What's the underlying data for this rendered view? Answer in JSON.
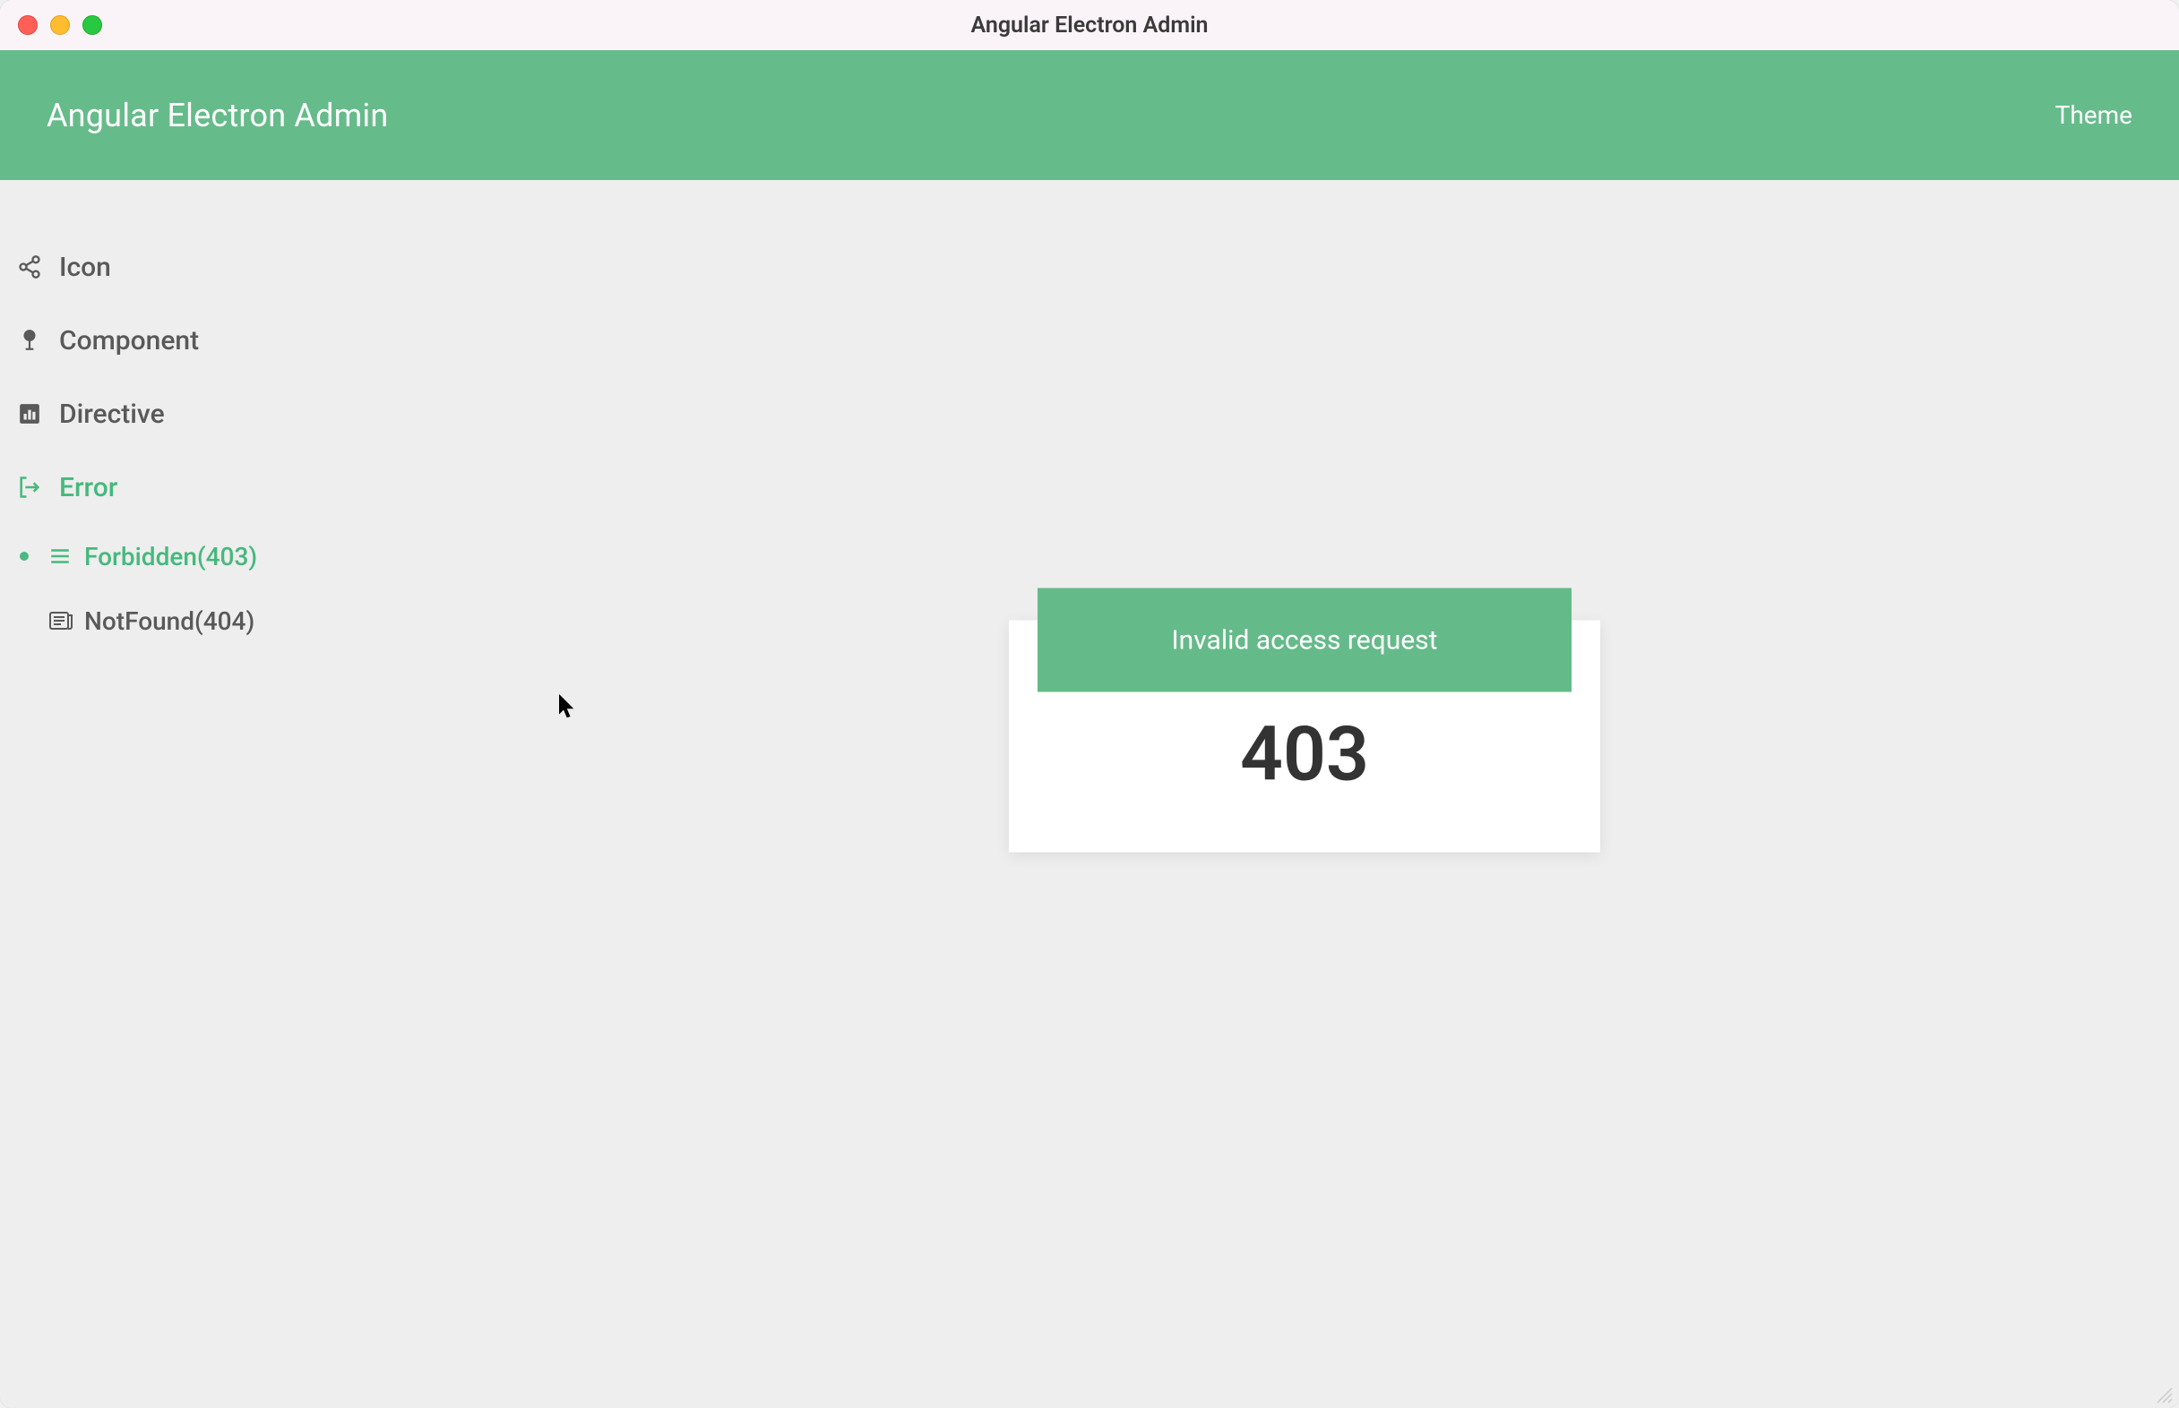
{
  "window": {
    "title": "Angular Electron Admin"
  },
  "header": {
    "title": "Angular Electron Admin",
    "theme_label": "Theme"
  },
  "colors": {
    "accent": "#66bb8a",
    "accent_text": "#45b97c",
    "body_bg": "#eeeeee"
  },
  "sidebar": {
    "items": [
      {
        "icon": "share-icon",
        "label": "Icon",
        "active": false
      },
      {
        "icon": "tree-icon",
        "label": "Component",
        "active": false
      },
      {
        "icon": "bar-chart-icon",
        "label": "Directive",
        "active": false
      },
      {
        "icon": "exit-icon",
        "label": "Error",
        "active": true
      }
    ],
    "subitems": [
      {
        "icon": "menu-icon",
        "label": "Forbidden(403)",
        "active": true
      },
      {
        "icon": "news-icon",
        "label": "NotFound(404)",
        "active": false
      }
    ]
  },
  "error": {
    "banner_text": "Invalid access request",
    "code": "403"
  }
}
